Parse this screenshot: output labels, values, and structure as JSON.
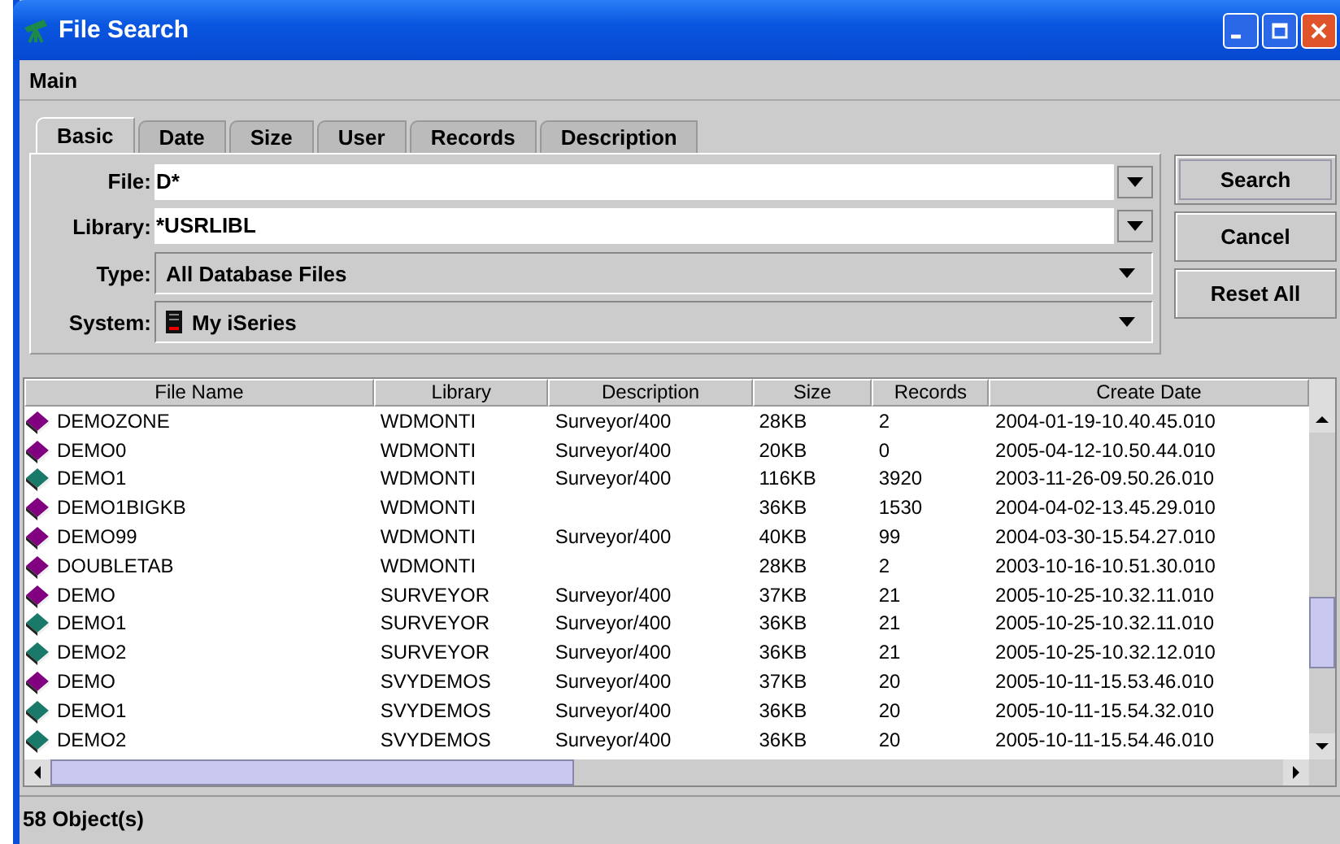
{
  "window": {
    "title": "File Search"
  },
  "menu": [
    "Main"
  ],
  "tabs": [
    {
      "label": "Basic",
      "selected": true
    },
    {
      "label": "Date",
      "selected": false
    },
    {
      "label": "Size",
      "selected": false
    },
    {
      "label": "User",
      "selected": false
    },
    {
      "label": "Records",
      "selected": false
    },
    {
      "label": "Description",
      "selected": false
    }
  ],
  "fields": [
    {
      "label": "File:",
      "value": "D*",
      "kind": "editable"
    },
    {
      "label": "Library:",
      "value": "*USRLIBL",
      "kind": "editable"
    },
    {
      "label": "Type:",
      "value": "All Database Files",
      "kind": "choice"
    },
    {
      "label": "System:",
      "value": "My iSeries",
      "kind": "system"
    }
  ],
  "buttons": [
    "Search",
    "Cancel",
    "Reset All"
  ],
  "table": {
    "columns": [
      "File Name",
      "Library",
      "Description",
      "Size",
      "Records",
      "Create Date"
    ],
    "rows": [
      {
        "cells": [
          "DEMOZONE",
          "WDMONTI",
          "Surveyor/400",
          "28KB",
          "2",
          "2004-01-19-10.40.45.010"
        ],
        "color": "#800080"
      },
      {
        "cells": [
          "DEMO0",
          "WDMONTI",
          "Surveyor/400",
          "20KB",
          "0",
          "2005-04-12-10.50.44.010"
        ],
        "color": "#800080"
      },
      {
        "cells": [
          "DEMO1",
          "WDMONTI",
          "Surveyor/400",
          "116KB",
          "3920",
          "2003-11-26-09.50.26.010"
        ],
        "color": "#1a7a6a"
      },
      {
        "cells": [
          "DEMO1BIGKB",
          "WDMONTI",
          "",
          "36KB",
          "1530",
          "2004-04-02-13.45.29.010"
        ],
        "color": "#800080"
      },
      {
        "cells": [
          "DEMO99",
          "WDMONTI",
          "Surveyor/400",
          "40KB",
          "99",
          "2004-03-30-15.54.27.010"
        ],
        "color": "#800080"
      },
      {
        "cells": [
          "DOUBLETAB",
          "WDMONTI",
          "",
          "28KB",
          "2",
          "2003-10-16-10.51.30.010"
        ],
        "color": "#800080"
      },
      {
        "cells": [
          "DEMO",
          "SURVEYOR",
          "Surveyor/400",
          "37KB",
          "21",
          "2005-10-25-10.32.11.010"
        ],
        "color": "#800080"
      },
      {
        "cells": [
          "DEMO1",
          "SURVEYOR",
          "Surveyor/400",
          "36KB",
          "21",
          "2005-10-25-10.32.11.010"
        ],
        "color": "#1a7a6a"
      },
      {
        "cells": [
          "DEMO2",
          "SURVEYOR",
          "Surveyor/400",
          "36KB",
          "21",
          "2005-10-25-10.32.12.010"
        ],
        "color": "#1a7a6a"
      },
      {
        "cells": [
          "DEMO",
          "SVYDEMOS",
          "Surveyor/400",
          "37KB",
          "20",
          "2005-10-11-15.53.46.010"
        ],
        "color": "#800080"
      },
      {
        "cells": [
          "DEMO1",
          "SVYDEMOS",
          "Surveyor/400",
          "36KB",
          "20",
          "2005-10-11-15.54.32.010"
        ],
        "color": "#1a7a6a"
      },
      {
        "cells": [
          "DEMO2",
          "SVYDEMOS",
          "Surveyor/400",
          "36KB",
          "20",
          "2005-10-11-15.54.46.010"
        ],
        "color": "#1a7a6a"
      }
    ]
  },
  "status_bar": "58 Object(s)"
}
